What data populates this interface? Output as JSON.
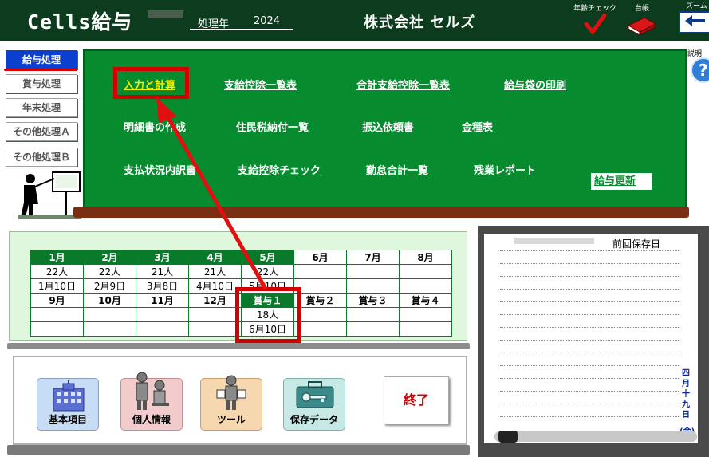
{
  "header": {
    "app_title": "Cells給与",
    "year_label": "処理年",
    "year_value": "2024",
    "company_name": "株式会社 セルズ",
    "age_check_label": "年齢チェック",
    "ledger_label": "台帳",
    "zoom_label": "ズーム",
    "help_label": "説明"
  },
  "nav": {
    "items": [
      "給与処理",
      "賞与処理",
      "年末処理",
      "その他処理Ａ",
      "その他処理Ｂ"
    ],
    "active_index": 0
  },
  "menu": {
    "row1": [
      "入力と計算",
      "支給控除一覧表",
      "合計支給控除一覧表",
      "給与袋の印刷"
    ],
    "row2": [
      "明細書の作成",
      "住民税納付一覧",
      "振込依頼書",
      "金種表"
    ],
    "row3": [
      "支払状況内訳書",
      "支給控除チェック",
      "勤怠合計一覧",
      "残業レポート"
    ],
    "update_label": "給与更新"
  },
  "calendar": {
    "months_row1": [
      "1月",
      "2月",
      "3月",
      "4月",
      "5月",
      "6月",
      "7月",
      "8月"
    ],
    "counts_row1": [
      "22人",
      "22人",
      "21人",
      "21人",
      "22人",
      "",
      "",
      ""
    ],
    "dates_row1": [
      "1月10日",
      "2月9日",
      "3月8日",
      "4月10日",
      "5月10日",
      "",
      "",
      ""
    ],
    "months_row2": [
      "9月",
      "10月",
      "11月",
      "12月",
      "賞与１",
      "賞与２",
      "賞与３",
      "賞与４"
    ],
    "counts_row2": [
      "",
      "",
      "",
      "",
      "18人",
      "",
      "",
      ""
    ],
    "dates_row2": [
      "",
      "",
      "",
      "",
      "6月10日",
      "",
      "",
      ""
    ]
  },
  "bottom": {
    "buttons": [
      "基本項目",
      "個人情報",
      "ツール",
      "保存データ"
    ],
    "exit_label": "終了"
  },
  "note": {
    "title": "前回保存日",
    "date_chars": [
      "四",
      "月",
      "十",
      "九",
      "日",
      "(金)"
    ]
  },
  "colors": {
    "green_panel": "#068c2e",
    "header_bg": "#0d3b1e",
    "highlight_red": "#d40000",
    "active_nav": "#0b3fcf"
  }
}
